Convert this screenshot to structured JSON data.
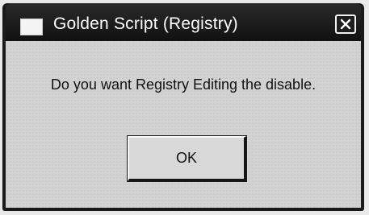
{
  "window": {
    "title": "Golden Script (Registry)"
  },
  "dialog": {
    "message": "Do you want Registry Editing the disable.",
    "ok_label": "OK"
  },
  "icons": {
    "app": "app-window-icon",
    "close": "close-icon"
  }
}
